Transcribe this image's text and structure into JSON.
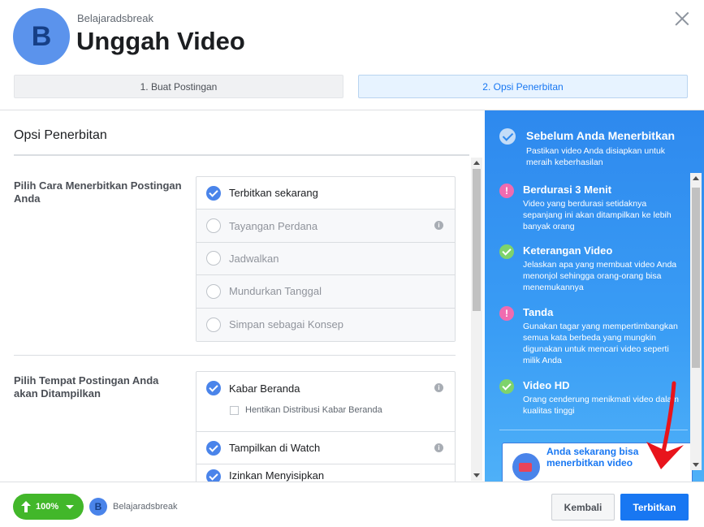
{
  "header": {
    "avatar_letter": "B",
    "page_name": "Belajaradsbreak",
    "title": "Unggah Video"
  },
  "steps": [
    {
      "label": "1. Buat Postingan"
    },
    {
      "label": "2. Opsi Penerbitan"
    }
  ],
  "main": {
    "section_title": "Opsi Penerbitan",
    "publish_method": {
      "label": "Pilih Cara Menerbitkan Postingan Anda",
      "options": [
        {
          "label": "Terbitkan sekarang"
        },
        {
          "label": "Tayangan Perdana"
        },
        {
          "label": "Jadwalkan"
        },
        {
          "label": "Mundurkan Tanggal"
        },
        {
          "label": "Simpan sebagai Konsep"
        }
      ]
    },
    "placement": {
      "label": "Pilih Tempat Postingan Anda akan Ditampilkan",
      "options": [
        {
          "label": "Kabar Beranda"
        },
        {
          "label": "Hentikan Distribusi Kabar Beranda"
        },
        {
          "label": "Tampilkan di Watch"
        },
        {
          "label": "Izinkan Menyisipkan"
        }
      ]
    }
  },
  "tips": {
    "title": "Sebelum Anda Menerbitkan",
    "subtitle": "Pastikan video Anda disiapkan untuk meraih keberhasilan",
    "items": [
      {
        "title": "Berdurasi 3 Menit",
        "text": "Video yang berdurasi setidaknya sepanjang ini akan ditampilkan ke lebih banyak orang"
      },
      {
        "title": "Keterangan Video",
        "text": "Jelaskan apa yang membuat video Anda menonjol sehingga orang-orang bisa menemukannya"
      },
      {
        "title": "Tanda",
        "text": "Gunakan tagar yang mempertimbangkan semua kata berbeda yang mungkin digunakan untuk mencari video seperti milik Anda"
      },
      {
        "title": "Video HD",
        "text": "Orang cenderung menikmati video dalam kualitas tinggi"
      }
    ],
    "promo_text": "Anda sekarang bisa menerbitkan video"
  },
  "footer": {
    "upload_progress": "100%",
    "avatar_letter": "B",
    "page_name": "Belajaradsbreak",
    "back_label": "Kembali",
    "publish_label": "Terbitkan"
  },
  "colors": {
    "accent": "#1877f2",
    "upload_green": "#42b72a",
    "warn_pink": "#f06bb0",
    "ok_green": "#7ed36b",
    "annotation_red": "#e8141c"
  }
}
